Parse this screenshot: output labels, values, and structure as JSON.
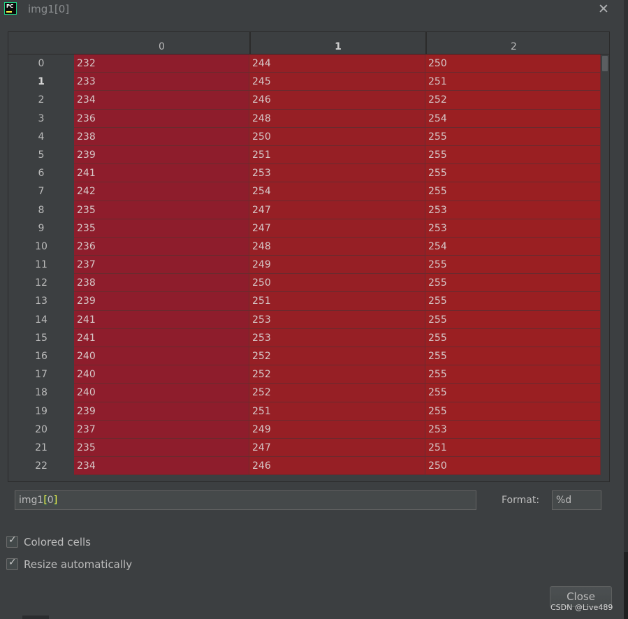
{
  "window": {
    "title": "img1[0]"
  },
  "table": {
    "columns": [
      "0",
      "1",
      "2"
    ],
    "bold_column": 1,
    "bold_row": 1,
    "rows": [
      {
        "index": "0",
        "values": [
          "232",
          "244",
          "250"
        ]
      },
      {
        "index": "1",
        "values": [
          "233",
          "245",
          "251"
        ]
      },
      {
        "index": "2",
        "values": [
          "234",
          "246",
          "252"
        ]
      },
      {
        "index": "3",
        "values": [
          "236",
          "248",
          "254"
        ]
      },
      {
        "index": "4",
        "values": [
          "238",
          "250",
          "255"
        ]
      },
      {
        "index": "5",
        "values": [
          "239",
          "251",
          "255"
        ]
      },
      {
        "index": "6",
        "values": [
          "241",
          "253",
          "255"
        ]
      },
      {
        "index": "7",
        "values": [
          "242",
          "254",
          "255"
        ]
      },
      {
        "index": "8",
        "values": [
          "235",
          "247",
          "253"
        ]
      },
      {
        "index": "9",
        "values": [
          "235",
          "247",
          "253"
        ]
      },
      {
        "index": "10",
        "values": [
          "236",
          "248",
          "254"
        ]
      },
      {
        "index": "11",
        "values": [
          "237",
          "249",
          "255"
        ]
      },
      {
        "index": "12",
        "values": [
          "238",
          "250",
          "255"
        ]
      },
      {
        "index": "13",
        "values": [
          "239",
          "251",
          "255"
        ]
      },
      {
        "index": "14",
        "values": [
          "241",
          "253",
          "255"
        ]
      },
      {
        "index": "15",
        "values": [
          "241",
          "253",
          "255"
        ]
      },
      {
        "index": "16",
        "values": [
          "240",
          "252",
          "255"
        ]
      },
      {
        "index": "17",
        "values": [
          "240",
          "252",
          "255"
        ]
      },
      {
        "index": "18",
        "values": [
          "240",
          "252",
          "255"
        ]
      },
      {
        "index": "19",
        "values": [
          "239",
          "251",
          "255"
        ]
      },
      {
        "index": "20",
        "values": [
          "237",
          "249",
          "253"
        ]
      },
      {
        "index": "21",
        "values": [
          "235",
          "247",
          "251"
        ]
      },
      {
        "index": "22",
        "values": [
          "234",
          "246",
          "250"
        ]
      }
    ]
  },
  "expression": {
    "name": "img1",
    "bracket_open": "[",
    "index": "0",
    "bracket_close": "]"
  },
  "format": {
    "label": "Format:",
    "value": "%d"
  },
  "options": [
    {
      "label": "Colored cells",
      "checked": true
    },
    {
      "label": "Resize automatically",
      "checked": true
    }
  ],
  "buttons": {
    "close_label": "Close"
  },
  "watermark": "CSDN @Live489",
  "icons": {
    "app": "pycharm-icon",
    "close": "close-icon",
    "check": "checkmark-icon"
  },
  "colors": {
    "cell_col0": "#8e1d2c",
    "cell_col1": "#961f25",
    "cell_col2": "#9a1f22",
    "background": "#3c3f41"
  }
}
